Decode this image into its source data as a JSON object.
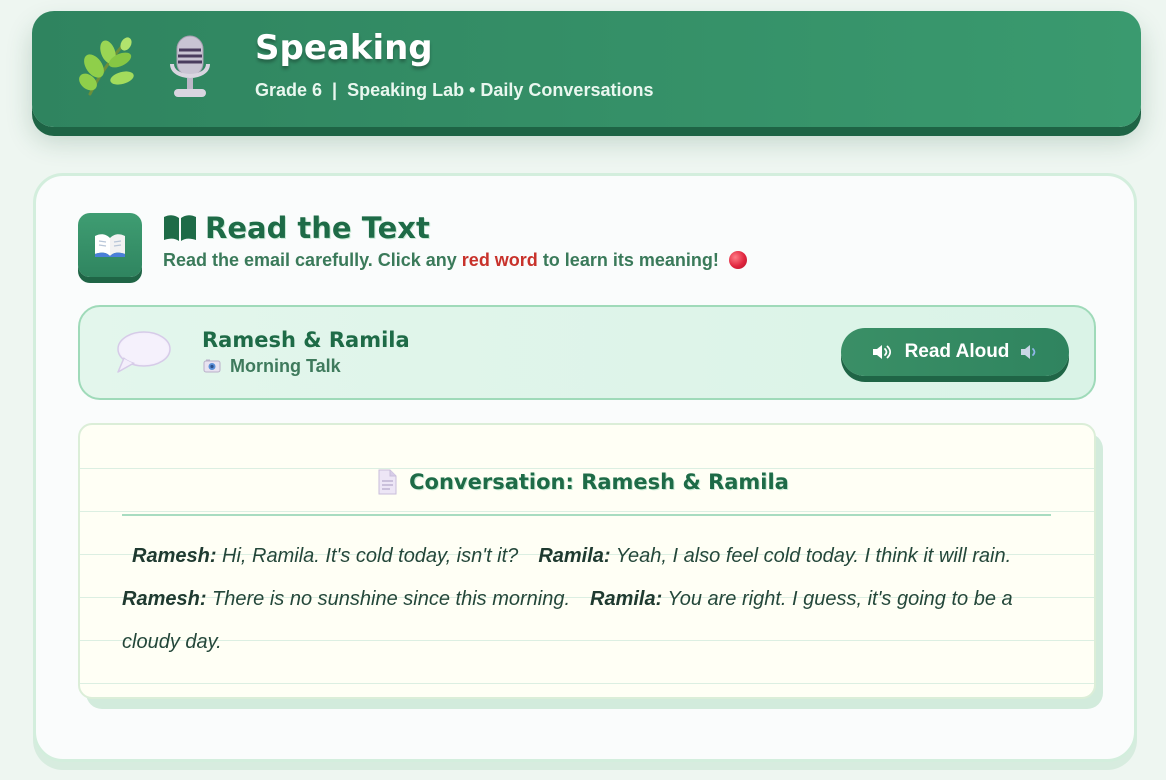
{
  "header": {
    "title": "Speaking",
    "subtitle": "Grade 6  |  Speaking Lab • Daily Conversations",
    "icons": [
      "herb-icon",
      "microphone-icon"
    ]
  },
  "section": {
    "title": "Read the Text",
    "instruction_before": "Read the email carefully. Click any",
    "instruction_highlight": "red word",
    "instruction_after": "to learn its meaning!",
    "icons": [
      "book-icon",
      "open-book-icon",
      "red-circle-icon"
    ]
  },
  "speaker_bar": {
    "name": "Ramesh & Ramila",
    "topic": "Morning Talk",
    "read_aloud_label": "Read Aloud",
    "icons": [
      "speech-bubble-icon",
      "camera-icon",
      "speaker-icon"
    ]
  },
  "conversation": {
    "title": "Conversation: Ramesh & Ramila",
    "lines": [
      {
        "speaker": "Ramesh:",
        "text": "Hi, Ramila. It's cold today, isn't it?"
      },
      {
        "speaker": "Ramila:",
        "text": "Yeah, I also feel cold today. I think it will rain."
      },
      {
        "speaker": "Ramesh:",
        "text": "There is no sunshine since this morning."
      },
      {
        "speaker": "Ramila:",
        "text": "You are right. I guess, it's going to be a cloudy day."
      }
    ],
    "icons": [
      "page-icon"
    ]
  },
  "colors": {
    "primary_green": "#2f845f",
    "dark_green_text": "#1e6b47",
    "highlight_red": "#c8322b",
    "page_background": "#eef6f1",
    "paper_background": "#fffff5"
  }
}
